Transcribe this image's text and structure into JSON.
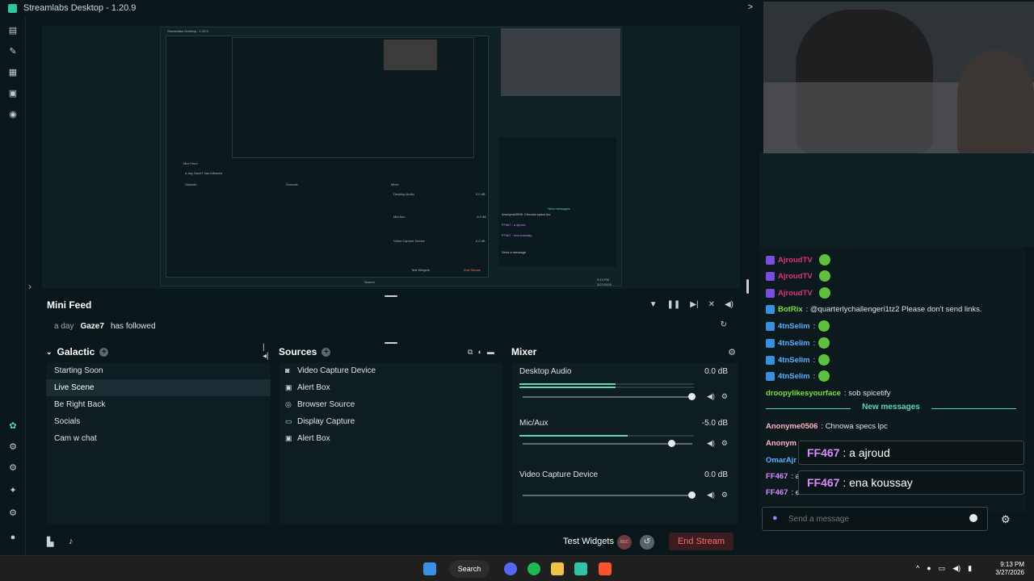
{
  "window": {
    "title": "Streamlabs Desktop - 1.20.9",
    "collapse": ">"
  },
  "nested": {
    "title": "Streamlabs Desktop - 1.20.9",
    "minifeed": "Mini Feed",
    "feed": "a day  Gaze7 has followed",
    "galactic": "Galactic",
    "sources": "Sources",
    "mixer": "Mixer",
    "desktop_audio": "Desktop Audio",
    "mic": "Mic/Aux",
    "vcd": "Video Capture Device",
    "db0": "0.0 dB",
    "dbm5": "-5.0 dB",
    "new_messages": "New messages",
    "line1": "Anonyme0506: Chnowa specs lpc",
    "alert1": "FF467 : a ajroud",
    "alert2": "FF467 : ena koussay",
    "send": "Send a message",
    "test": "Test Widgets",
    "end": "End Stream",
    "search": "Search",
    "time": "9:13 PM",
    "date": "3/27/2026"
  },
  "minifeed": {
    "title": "Mini Feed",
    "time": "a day",
    "user": "Gaze7",
    "action": "has followed"
  },
  "scenes": {
    "title": "Galactic",
    "items": [
      "Starting Soon",
      "Live Scene",
      "Be Right Back",
      "Socials",
      "Cam w chat"
    ],
    "active": "Live Scene"
  },
  "sources": {
    "title": "Sources",
    "items": [
      {
        "label": "Video Capture Device",
        "icon": "camera-icon"
      },
      {
        "label": "Alert Box",
        "icon": "alert-icon"
      },
      {
        "label": "Browser Source",
        "icon": "globe-icon"
      },
      {
        "label": "Display Capture",
        "icon": "monitor-icon"
      },
      {
        "label": "Alert Box",
        "icon": "alert-icon"
      }
    ]
  },
  "mixer": {
    "title": "Mixer",
    "channels": [
      {
        "name": "Desktop Audio",
        "db": "0.0 dB",
        "level": 0.55,
        "volume": 1.0
      },
      {
        "name": "Mic/Aux",
        "db": "-5.0 dB",
        "level": 0.62,
        "volume": 0.88
      },
      {
        "name": "Video Capture Device",
        "db": "0.0 dB",
        "level": 0.0,
        "volume": 1.0
      }
    ]
  },
  "footer": {
    "test_widgets": "Test Widgets",
    "rec": "REC",
    "end_stream": "End Stream"
  },
  "chat": {
    "lines": [
      {
        "user": "AjroudTV",
        "color": "#e0307a",
        "text": "",
        "badge": "#7b4ce0"
      },
      {
        "user": "AjroudTV",
        "color": "#e0307a",
        "text": "",
        "badge": "#7b4ce0"
      },
      {
        "user": "AjroudTV",
        "color": "#e0307a",
        "text": "",
        "badge": "#7b4ce0"
      },
      {
        "user": "BotRix",
        "color": "#7fe040",
        "text": ": @quarterlychallengeri1tz2 Please don't send links.",
        "badge": "#3a8fe0"
      },
      {
        "user": "4tnSelim",
        "color": "#5ab0ff",
        "text": ":",
        "badge": "#3a8fe0"
      },
      {
        "user": "4tnSelim",
        "color": "#5ab0ff",
        "text": ":",
        "badge": "#3a8fe0"
      },
      {
        "user": "4tnSelim",
        "color": "#5ab0ff",
        "text": ":",
        "badge": "#3a8fe0"
      },
      {
        "user": "4tnSelim",
        "color": "#5ab0ff",
        "text": ":",
        "badge": "#3a8fe0"
      },
      {
        "user": "droopylikesyourface",
        "color": "#7fe040",
        "text": ": sob spicetify",
        "badge": ""
      }
    ],
    "new_messages": "New messages",
    "after": [
      {
        "user": "Anonyme0506",
        "color": "#ffb3c1",
        "text": ": Chnowa specs lpc"
      },
      {
        "user": "Anonym",
        "color": "#ffb3c1",
        "text": ""
      },
      {
        "user": "OmarAjr",
        "color": "#5ab0ff",
        "text": ""
      },
      {
        "user": "FF467",
        "color": "#d68dff",
        "text": ": a"
      },
      {
        "user": "FF467",
        "color": "#d68dff",
        "text": ": e"
      }
    ],
    "alerts": [
      {
        "name": "FF467",
        "text": " : a ajroud"
      },
      {
        "name": "FF467",
        "text": " : ena koussay"
      }
    ],
    "placeholder": "Send a message"
  },
  "taskbar": {
    "search": "Search",
    "time": "9:13 PM",
    "date": "3/27/2026"
  }
}
